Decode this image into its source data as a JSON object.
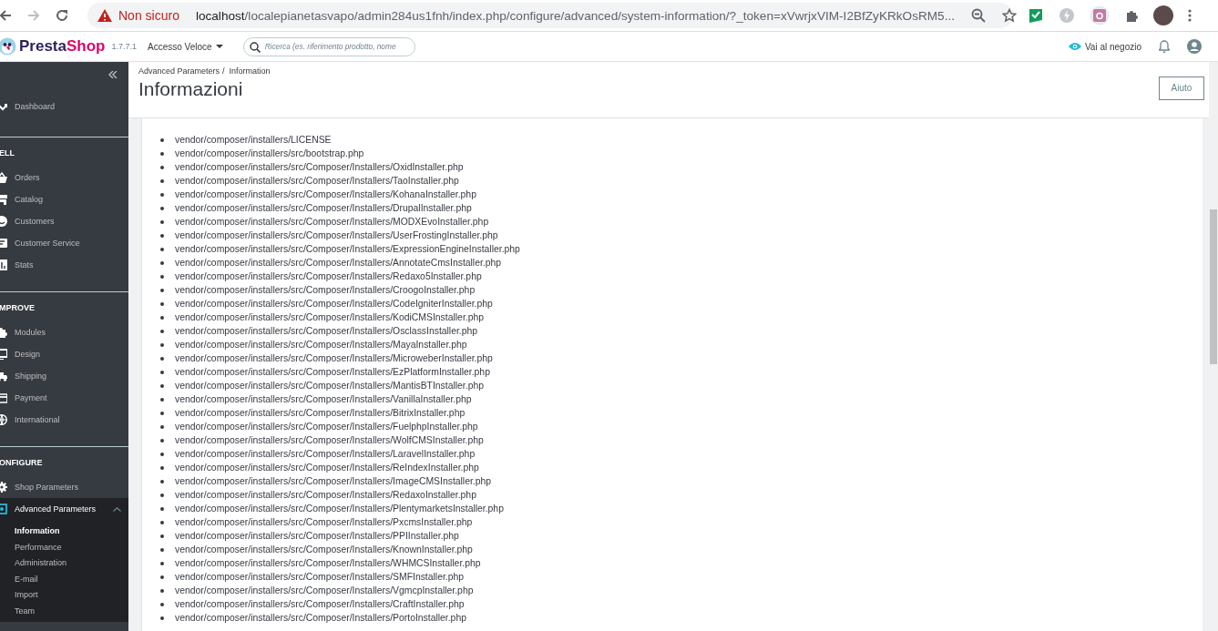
{
  "browser": {
    "security": "Non sicuro",
    "url_host": "localhost",
    "url_path": "/localepianetasvapo/admin284us1fnh/index.php/configure/advanced/system-information/?_token=xVwrjxVIM-I2BfZyKRkOsRM5..."
  },
  "header": {
    "logo": "PrestaShop",
    "version": "1.7.7.1",
    "quick_access": "Accesso Veloce",
    "search": {
      "placeholder": "Ricerca (es. riferimento prodotto, nome"
    },
    "shop_link": "Vai al negozio"
  },
  "sidebar": {
    "sections": [
      {
        "items": [
          {
            "label": "Dashboard",
            "selected": false,
            "expanded": false
          }
        ]
      },
      {
        "heading": "ELL",
        "items": [
          {
            "label": "Orders",
            "selected": false,
            "expanded": false
          },
          {
            "label": "Catalog",
            "selected": false,
            "expanded": false
          },
          {
            "label": "Customers",
            "selected": false,
            "expanded": false
          },
          {
            "label": "Customer Service",
            "selected": false,
            "expanded": false
          },
          {
            "label": "Stats",
            "selected": false,
            "expanded": false
          }
        ]
      },
      {
        "heading": "MPROVE",
        "items": [
          {
            "label": "Modules",
            "selected": false,
            "expanded": false
          },
          {
            "label": "Design",
            "selected": false,
            "expanded": false
          },
          {
            "label": "Shipping",
            "selected": false,
            "expanded": false
          },
          {
            "label": "Payment",
            "selected": false,
            "expanded": false
          },
          {
            "label": "International",
            "selected": false,
            "expanded": false
          }
        ]
      },
      {
        "heading": "ONFIGURE",
        "items": [
          {
            "label": "Shop Parameters",
            "selected": false,
            "expanded": false
          },
          {
            "label": "Advanced Parameters",
            "selected": true,
            "expanded": true,
            "children": [
              {
                "label": "Information",
                "selected": true
              },
              {
                "label": "Performance",
                "selected": false
              },
              {
                "label": "Administration",
                "selected": false
              },
              {
                "label": "E-mail",
                "selected": false
              },
              {
                "label": "Import",
                "selected": false
              },
              {
                "label": "Team",
                "selected": false
              }
            ]
          }
        ]
      }
    ]
  },
  "page": {
    "breadcrumb": [
      "Advanced Parameters",
      "Information"
    ],
    "breadcrumb_separator": "/",
    "title": "Informazioni",
    "help_button": "Aiuto"
  },
  "missing_files": [
    "vendor/composer/installers/LICENSE",
    "vendor/composer/installers/src/bootstrap.php",
    "vendor/composer/installers/src/Composer/Installers/OxidInstaller.php",
    "vendor/composer/installers/src/Composer/Installers/TaoInstaller.php",
    "vendor/composer/installers/src/Composer/Installers/KohanaInstaller.php",
    "vendor/composer/installers/src/Composer/Installers/DrupalInstaller.php",
    "vendor/composer/installers/src/Composer/Installers/MODXEvoInstaller.php",
    "vendor/composer/installers/src/Composer/Installers/UserFrostingInstaller.php",
    "vendor/composer/installers/src/Composer/Installers/ExpressionEngineInstaller.php",
    "vendor/composer/installers/src/Composer/Installers/AnnotateCmsInstaller.php",
    "vendor/composer/installers/src/Composer/Installers/Redaxo5Installer.php",
    "vendor/composer/installers/src/Composer/Installers/CroogoInstaller.php",
    "vendor/composer/installers/src/Composer/Installers/CodeIgniterInstaller.php",
    "vendor/composer/installers/src/Composer/Installers/KodiCMSInstaller.php",
    "vendor/composer/installers/src/Composer/Installers/OsclassInstaller.php",
    "vendor/composer/installers/src/Composer/Installers/MayaInstaller.php",
    "vendor/composer/installers/src/Composer/Installers/MicroweberInstaller.php",
    "vendor/composer/installers/src/Composer/Installers/EzPlatformInstaller.php",
    "vendor/composer/installers/src/Composer/Installers/MantisBTInstaller.php",
    "vendor/composer/installers/src/Composer/Installers/VanillaInstaller.php",
    "vendor/composer/installers/src/Composer/Installers/BitrixInstaller.php",
    "vendor/composer/installers/src/Composer/Installers/FuelphpInstaller.php",
    "vendor/composer/installers/src/Composer/Installers/WolfCMSInstaller.php",
    "vendor/composer/installers/src/Composer/Installers/LaravelInstaller.php",
    "vendor/composer/installers/src/Composer/Installers/ReIndexInstaller.php",
    "vendor/composer/installers/src/Composer/Installers/ImageCMSInstaller.php",
    "vendor/composer/installers/src/Composer/Installers/RedaxoInstaller.php",
    "vendor/composer/installers/src/Composer/Installers/PlentymarketsInstaller.php",
    "vendor/composer/installers/src/Composer/Installers/PxcmsInstaller.php",
    "vendor/composer/installers/src/Composer/Installers/PPIInstaller.php",
    "vendor/composer/installers/src/Composer/Installers/KnownInstaller.php",
    "vendor/composer/installers/src/Composer/Installers/WHMCSInstaller.php",
    "vendor/composer/installers/src/Composer/Installers/SMFInstaller.php",
    "vendor/composer/installers/src/Composer/Installers/VgmcpInstaller.php",
    "vendor/composer/installers/src/Composer/Installers/CraftInstaller.php",
    "vendor/composer/installers/src/Composer/Installers/PortoInstaller.php"
  ]
}
